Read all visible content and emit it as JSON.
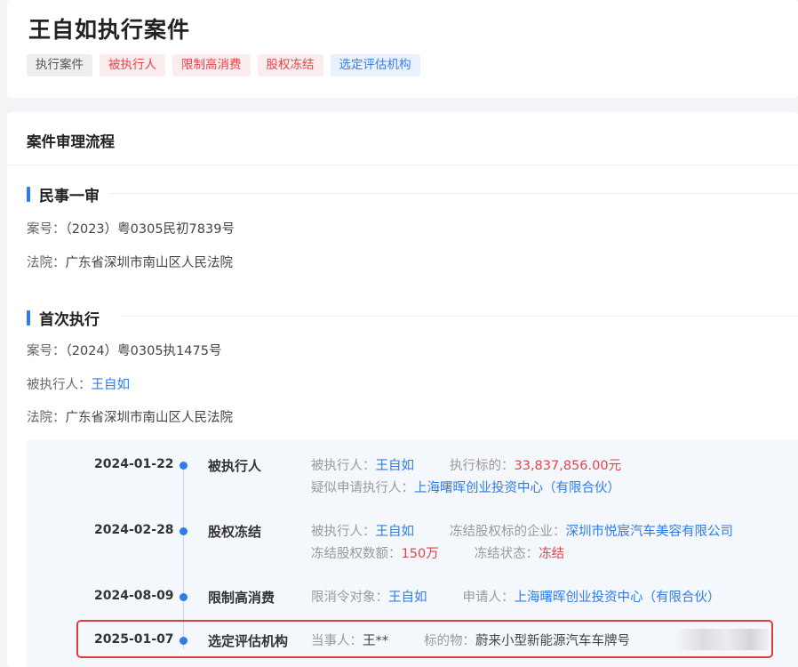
{
  "title": "王自如执行案件",
  "tags": [
    {
      "label": "执行案件",
      "style": "gray"
    },
    {
      "label": "被执行人",
      "style": "red"
    },
    {
      "label": "限制高消费",
      "style": "red"
    },
    {
      "label": "股权冻结",
      "style": "red"
    },
    {
      "label": "选定评估机构",
      "style": "blue"
    }
  ],
  "process_title": "案件审理流程",
  "first_trial": {
    "name": "民事一审",
    "case_no_label": "案号：",
    "case_no": "（2023）粤0305民初7839号",
    "court_label": "法院：",
    "court": "广东省深圳市南山区人民法院"
  },
  "first_execution": {
    "name": "首次执行",
    "case_no_label": "案号：",
    "case_no": "（2024）粤0305执1475号",
    "executed_label": "被执行人：",
    "executed": "王自如",
    "court_label": "法院：",
    "court": "广东省深圳市南山区人民法院"
  },
  "timeline": [
    {
      "date": "2024-01-22",
      "type": "被执行人",
      "line1": [
        {
          "k": "被执行人：",
          "v": "王自如",
          "c": "blue"
        },
        {
          "k": "执行标的：",
          "v": "33,837,856.00元",
          "c": "red"
        }
      ],
      "line2": [
        {
          "k": "疑似申请执行人：",
          "v": "上海曙晖创业投资中心（有限合伙）",
          "c": "blue"
        }
      ]
    },
    {
      "date": "2024-02-28",
      "type": "股权冻结",
      "line1": [
        {
          "k": "被执行人：",
          "v": "王自如",
          "c": "blue"
        },
        {
          "k": "冻结股权标的企业：",
          "v": "深圳市悦宸汽车美容有限公司",
          "c": "blue"
        }
      ],
      "line2": [
        {
          "k": "冻结股权数额：",
          "v": "150万",
          "c": "red"
        },
        {
          "k": "冻结状态：",
          "v": "冻结",
          "c": "red"
        }
      ]
    },
    {
      "date": "2024-08-09",
      "type": "限制高消费",
      "line1": [
        {
          "k": "限消令对象：",
          "v": "王自如",
          "c": "blue"
        },
        {
          "k": "申请人：",
          "v": "上海曙晖创业投资中心（有限合伙）",
          "c": "blue"
        }
      ]
    },
    {
      "date": "2025-01-07",
      "type": "选定评估机构",
      "line1": [
        {
          "k": "当事人：",
          "v": "王**",
          "c": "plain"
        },
        {
          "k": "标的物：",
          "v": "蔚来小型新能源汽车车牌号",
          "c": "plain"
        }
      ]
    }
  ],
  "colors": {
    "accent": "#2f7bea",
    "danger": "#e0454b",
    "highlight_border": "#e23b3b"
  }
}
